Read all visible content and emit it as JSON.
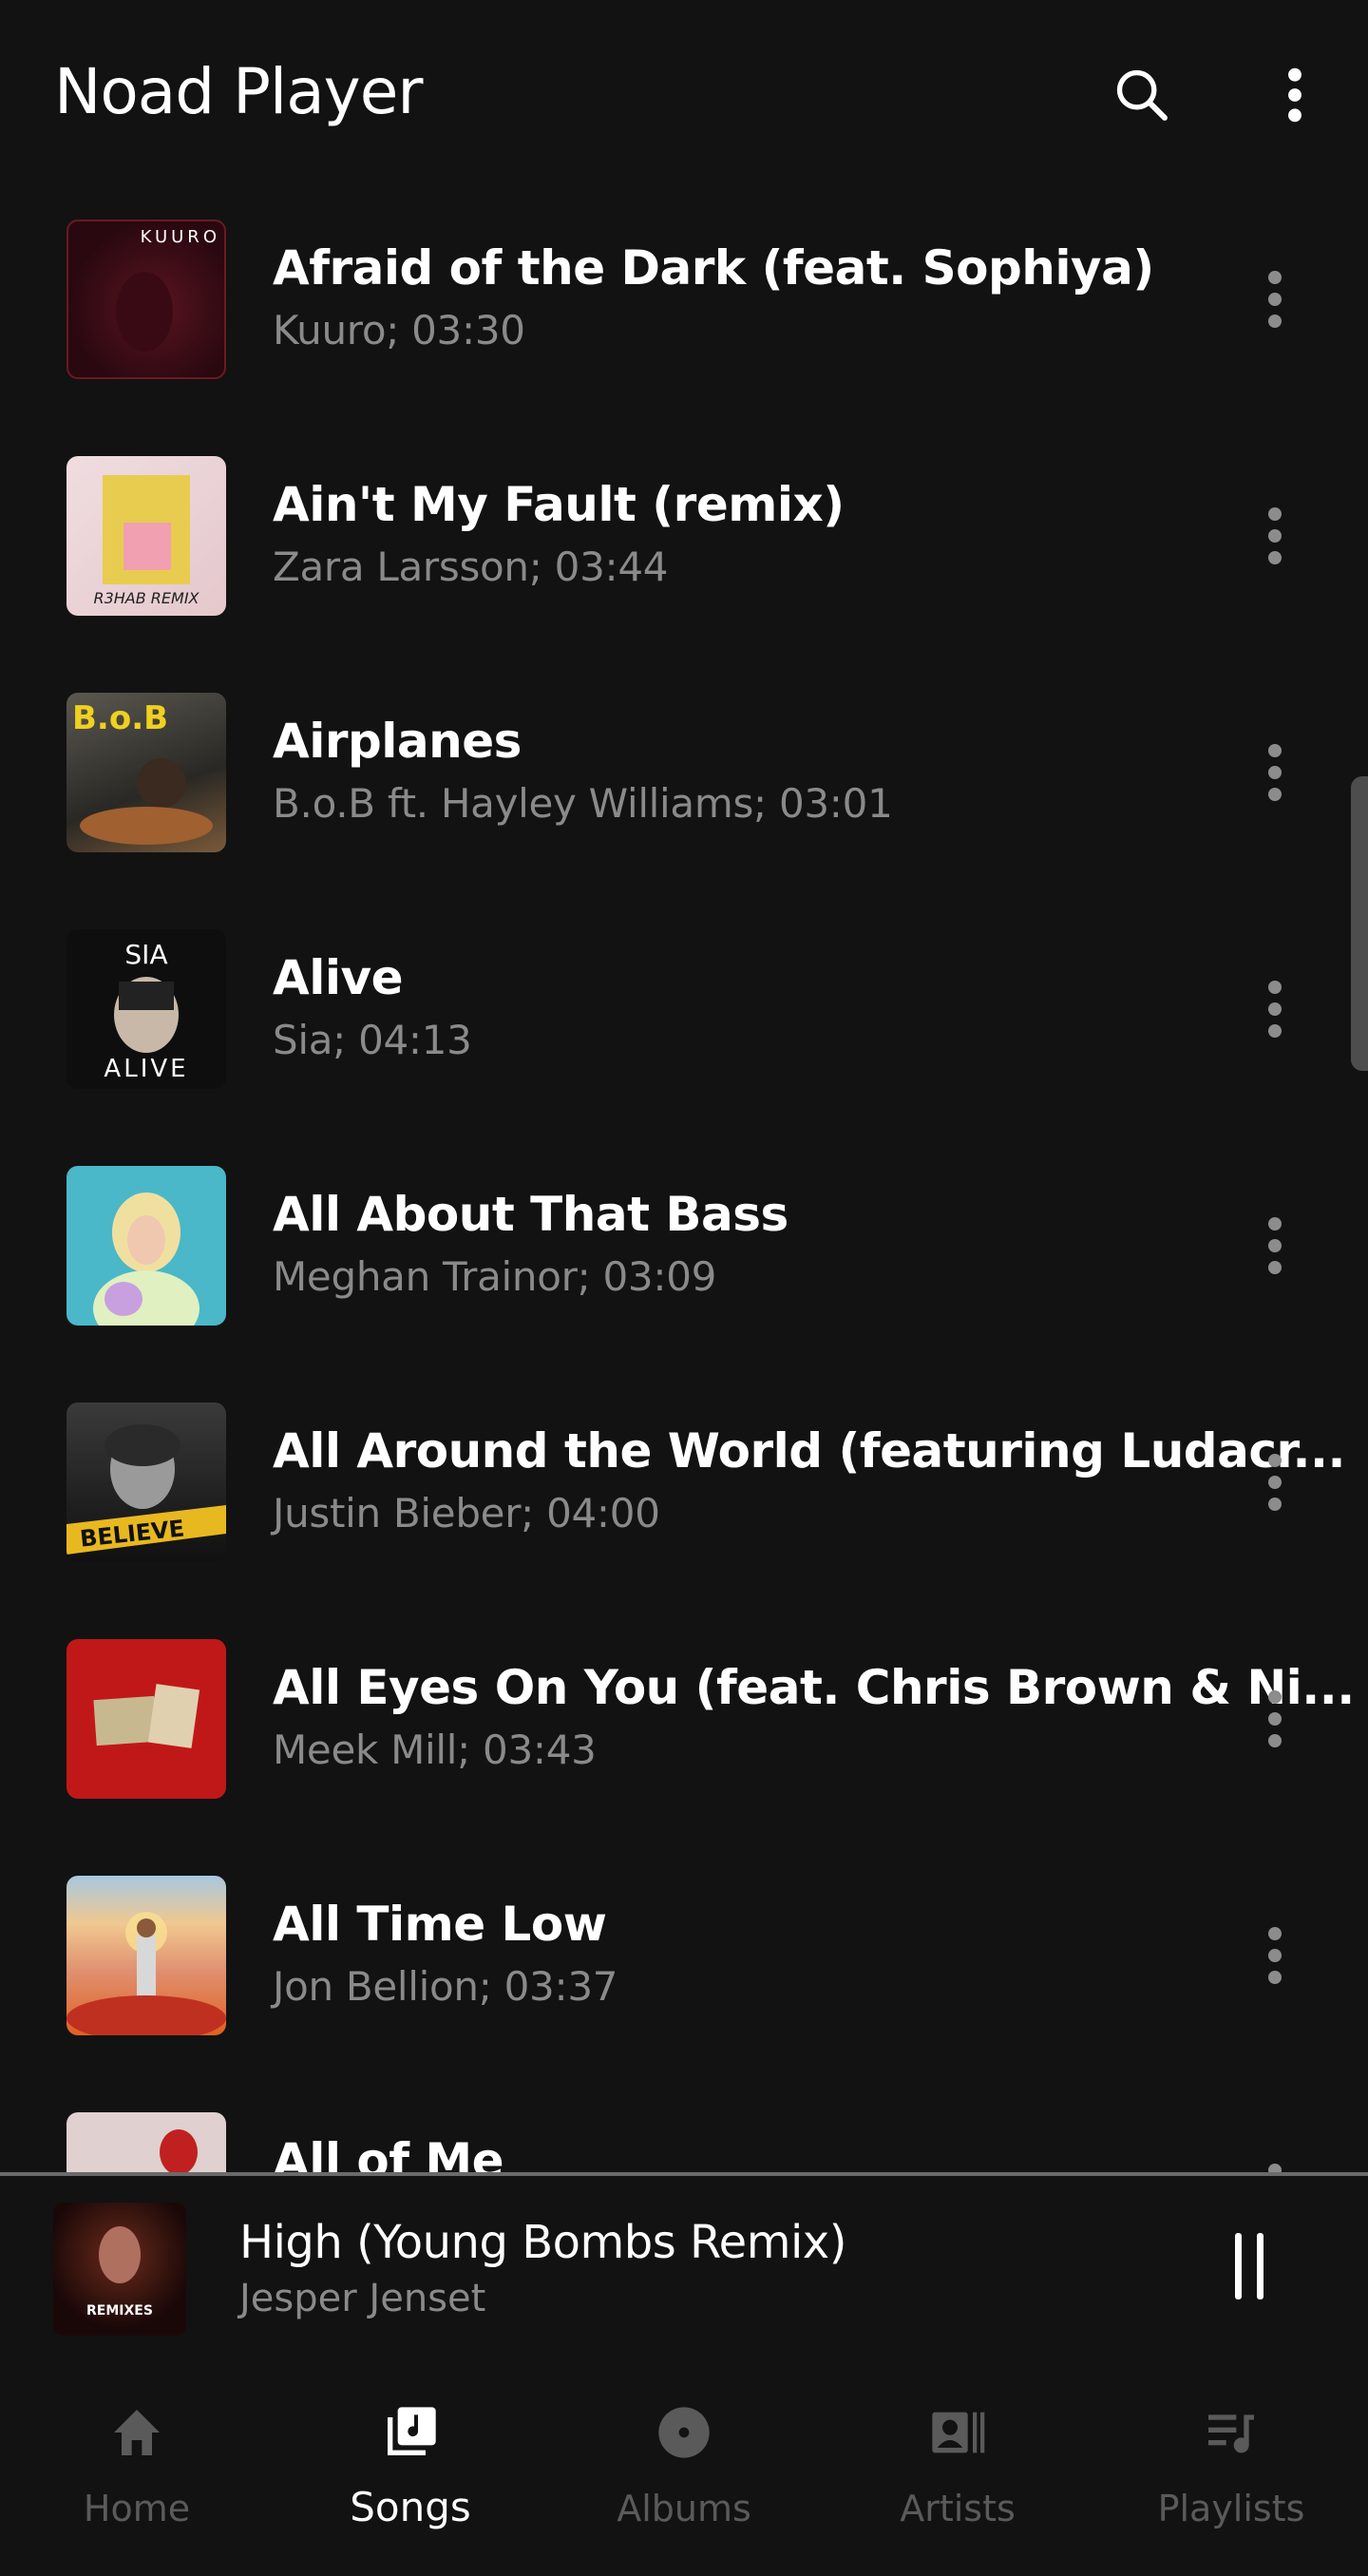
{
  "appbar": {
    "title": "Noad Player",
    "search_icon": "search-icon",
    "more_icon": "more-vert-icon"
  },
  "songs": [
    {
      "title": "Afraid of the Dark (feat. Sophiya)",
      "subtitle": "Kuuro; 03:30",
      "art": "kuuro-afraid-of-the-dark-cover"
    },
    {
      "title": "Ain't My Fault (remix)",
      "subtitle": "Zara Larsson; 03:44",
      "art": "zara-larsson-aint-my-fault-cover"
    },
    {
      "title": "Airplanes",
      "subtitle": "B.o.B ft. Hayley Williams; 03:01",
      "art": "bob-airplanes-cover"
    },
    {
      "title": "Alive",
      "subtitle": "Sia; 04:13",
      "art": "sia-alive-cover"
    },
    {
      "title": "All About That Bass",
      "subtitle": "Meghan Trainor; 03:09",
      "art": "meghan-trainor-title-cover"
    },
    {
      "title": "All Around the World (featuring Ludacr...",
      "subtitle": "Justin Bieber; 04:00",
      "art": "justin-bieber-believe-cover"
    },
    {
      "title": "All Eyes On You (feat. Chris Brown & Ni...",
      "subtitle": "Meek Mill; 03:43",
      "art": "meek-mill-dreams-worth-more-cover"
    },
    {
      "title": "All Time Low",
      "subtitle": "Jon Bellion; 03:37",
      "art": "jon-bellion-human-condition-cover"
    },
    {
      "title": "All of Me",
      "subtitle": "",
      "art": "all-of-me-rose-cover"
    }
  ],
  "mini_player": {
    "title": "High (Young Bombs Remix)",
    "artist": "Jesper Jenset",
    "art_text": "REMIXES",
    "state": "playing"
  },
  "bottom_nav": {
    "active": "Songs",
    "items": [
      {
        "label": "Home",
        "icon": "home-icon"
      },
      {
        "label": "Songs",
        "icon": "library-music-icon"
      },
      {
        "label": "Albums",
        "icon": "album-icon"
      },
      {
        "label": "Artists",
        "icon": "artist-icon"
      },
      {
        "label": "Playlists",
        "icon": "playlist-icon"
      }
    ]
  },
  "colors": {
    "background": "#121212",
    "text_primary": "#ffffff",
    "text_secondary": "#8a8a8a",
    "nav_inactive": "#5a5a5a",
    "divider": "#6a6a6a"
  }
}
